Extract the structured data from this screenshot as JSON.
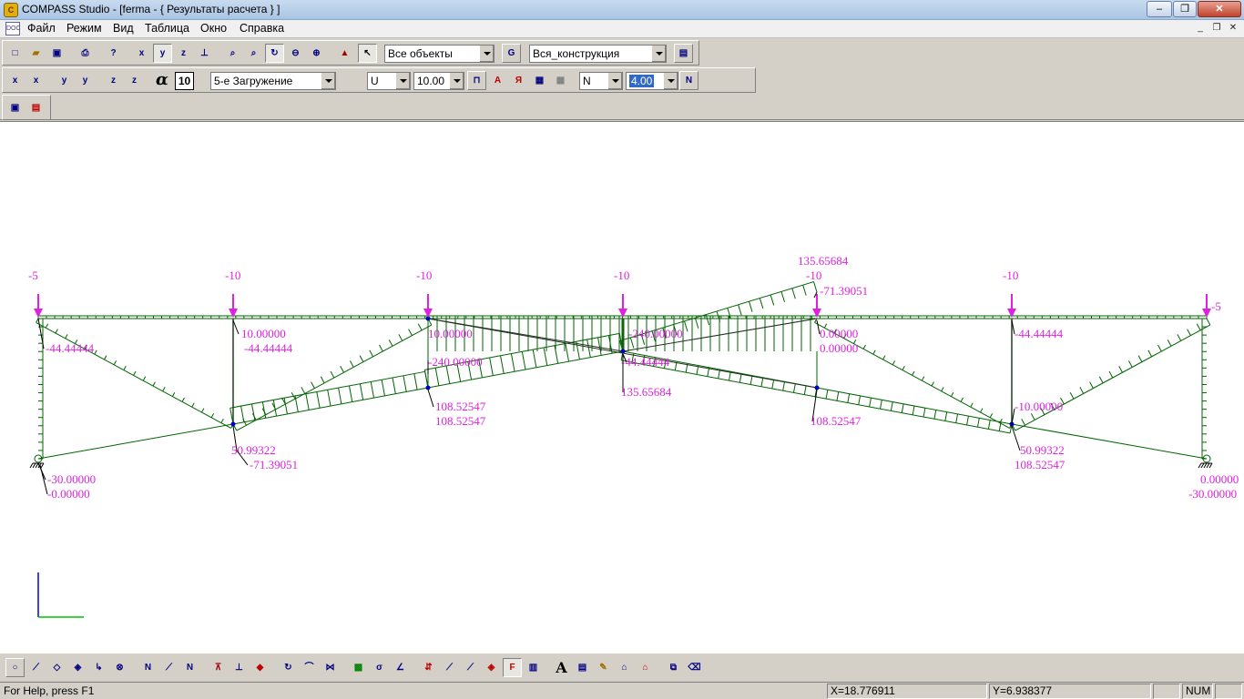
{
  "window": {
    "title": "COMPASS  Studio - [ferma - { Результаты расчета } ]",
    "minimize_label": "‒",
    "maximize_label": "❐",
    "close_label": "✕",
    "mdi_minimize": "_",
    "mdi_restore": "❐",
    "mdi_close": "✕"
  },
  "menu": {
    "items": [
      "Файл",
      "Режим",
      "Вид",
      "Таблица",
      "Окно",
      "Справка"
    ]
  },
  "toolbar": {
    "objects_combo": "Все объекты",
    "construction_combo": "Вся_конструкция",
    "alpha_symbol": "α",
    "alpha_value": "10",
    "load_case_combo": "5-е Загружение",
    "component_combo": "U",
    "scale_combo": "10.00",
    "force_combo": "N",
    "precision_combo": "4.00"
  },
  "diagram": {
    "load_labels": [
      "-5",
      "-10",
      "-10",
      "-10",
      "-10",
      "-10",
      "-5"
    ],
    "value_labels": [
      "135.65684",
      "-71.39051",
      "-44.44444",
      "10.00000",
      "-44.44444",
      "0.00000",
      "-240.00000",
      "10.00000",
      "-240.00000",
      "-44.44444",
      "0.00000",
      "-44.44444",
      "108.52547",
      "108.52547",
      "135.65684",
      "108.52547",
      "-10.00000",
      "50.99322",
      "-71.39051",
      "50.99322",
      "108.52547",
      "-30.00000",
      "-0.00000",
      "0.00000",
      "-30.00000"
    ],
    "line_color": "#006400",
    "label_color": "#e020e0"
  },
  "status": {
    "help_text": "For Help, press F1",
    "x_coord": "X=18.776911",
    "y_coord": "Y=6.938377",
    "num": "NUM"
  }
}
